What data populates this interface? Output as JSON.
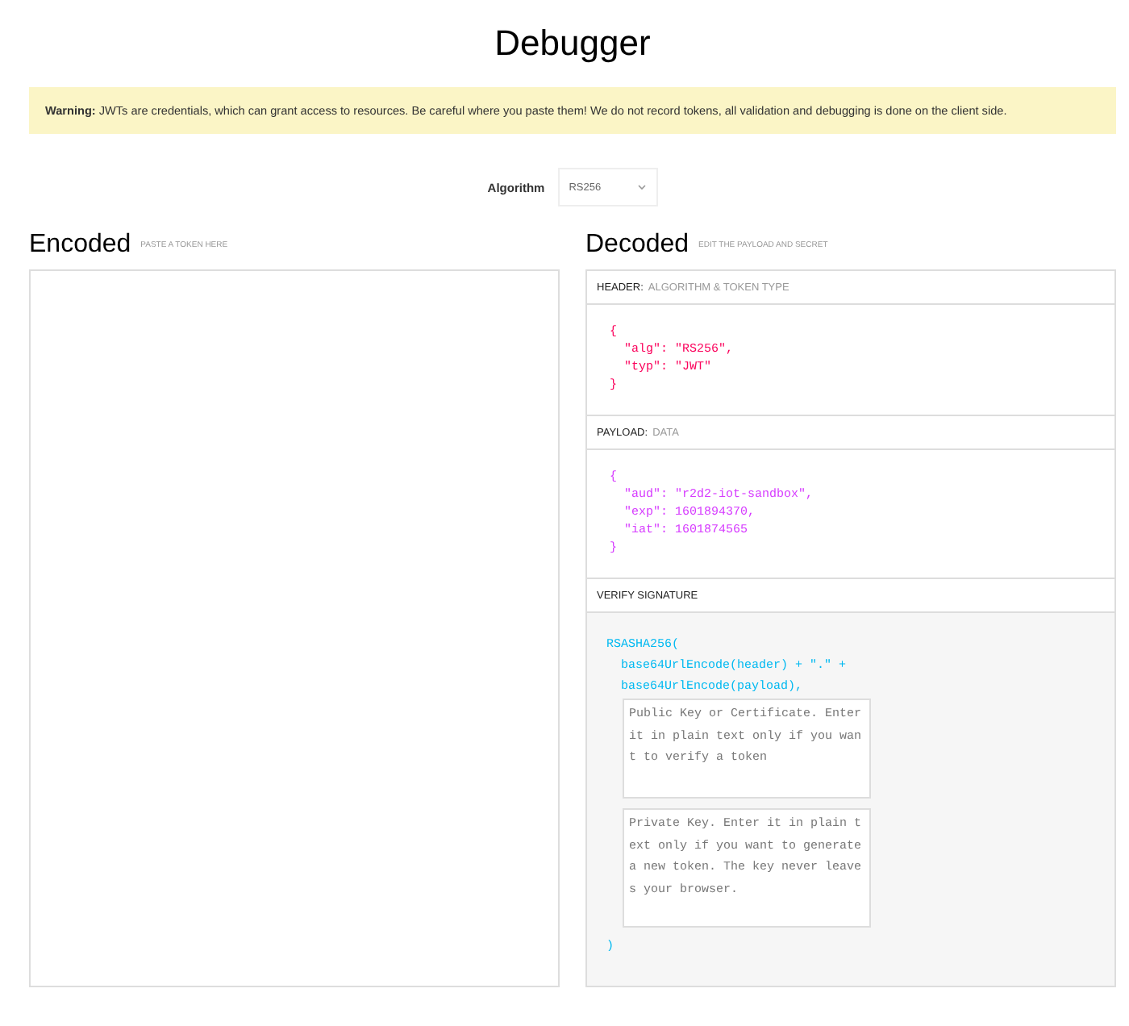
{
  "title": "Debugger",
  "warning": {
    "label": "Warning:",
    "text": "JWTs are credentials, which can grant access to resources. Be careful where you paste them! We do not record tokens, all validation and debugging is done on the client side."
  },
  "algorithm": {
    "label": "Algorithm",
    "value": "RS256"
  },
  "encoded": {
    "title": "Encoded",
    "hint": "PASTE A TOKEN HERE"
  },
  "decoded": {
    "title": "Decoded",
    "hint": "EDIT THE PAYLOAD AND SECRET",
    "sections": [
      {
        "kind": "code",
        "title": "HEADER:",
        "subtitle": "ALGORITHM & TOKEN TYPE",
        "color": "#fb015b",
        "lines": [
          "{",
          "  \"alg\": \"RS256\",",
          "  \"typ\": \"JWT\"",
          "}"
        ]
      },
      {
        "kind": "code",
        "title": "PAYLOAD:",
        "subtitle": "DATA",
        "color": "#d63aff",
        "lines": [
          "{",
          "  \"aud\": \"r2d2-iot-sandbox\",",
          "  \"exp\": 1601894370,",
          "  \"iat\": 1601874565",
          "}"
        ]
      },
      {
        "kind": "signature",
        "title": "VERIFY SIGNATURE",
        "color": "#00b9f1",
        "lines": [
          "RSASHA256(",
          "  base64UrlEncode(header) + \".\" +",
          "  base64UrlEncode(payload),"
        ],
        "keys": [
          {
            "placeholder": "Public Key or Certificate. Enter it in plain text only if you want to verify a token"
          },
          {
            "placeholder": "Private Key. Enter it in plain text only if you want to generate a new token. The key never leaves your browser."
          }
        ],
        "closing": ")"
      }
    ]
  }
}
